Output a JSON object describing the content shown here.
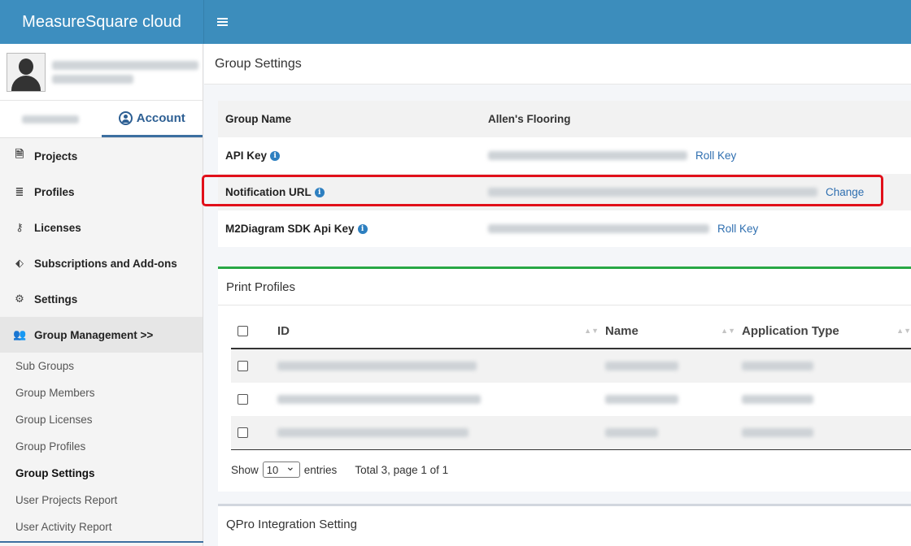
{
  "app": {
    "brand": "MeasureSquare cloud"
  },
  "sidebar": {
    "tabs": {
      "account_label": "Account"
    },
    "nav": [
      {
        "label": "Projects",
        "icon": "file-icon"
      },
      {
        "label": "Profiles",
        "icon": "database-icon"
      },
      {
        "label": "Licenses",
        "icon": "key-icon"
      },
      {
        "label": "Subscriptions and Add-ons",
        "icon": "tags-icon"
      },
      {
        "label": "Settings",
        "icon": "gear-icon"
      },
      {
        "label": "Group Management >>",
        "icon": "users-icon"
      }
    ],
    "sub_items": [
      "Sub Groups",
      "Group Members",
      "Group Licenses",
      "Group Profiles",
      "Group Settings",
      "User Projects Report",
      "User Activity Report"
    ]
  },
  "page": {
    "title": "Group Settings"
  },
  "settings": {
    "group_name_label": "Group Name",
    "group_name_value": "Allen's Flooring",
    "api_key_label": "API Key",
    "api_key_action": "Roll Key",
    "notification_url_label": "Notification URL",
    "notification_url_action": "Change",
    "sdk_key_label": "M2Diagram SDK Api Key",
    "sdk_key_action": "Roll Key"
  },
  "print_profiles": {
    "title": "Print Profiles",
    "columns": [
      "ID",
      "Name",
      "Application Type"
    ],
    "footer_show": "Show",
    "page_size": "10",
    "footer_entries": "entries",
    "footer_total": "Total 3, page 1 of 1"
  },
  "qpro": {
    "title": "QPro Integration Setting"
  },
  "colors": {
    "topbar": "#3c8dbc",
    "highlight": "#e1101a",
    "accent_green": "#28a745",
    "link": "#2f6fb0"
  }
}
